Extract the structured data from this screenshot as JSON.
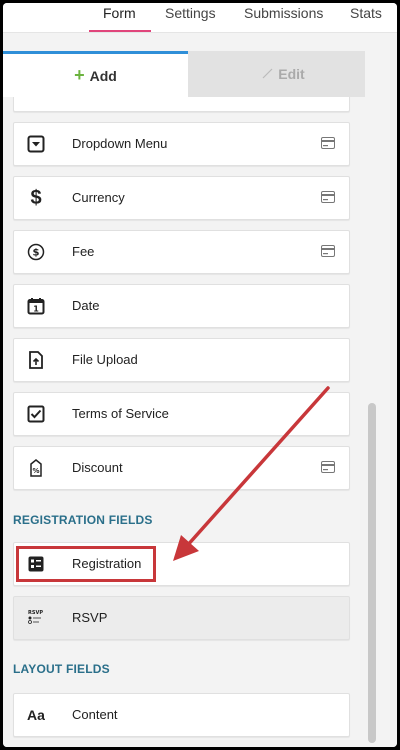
{
  "topnav": {
    "tabs": [
      "Form",
      "Settings",
      "Submissions",
      "Stats"
    ],
    "active": "Form"
  },
  "panel_tabs": {
    "add_label": "Add",
    "edit_label": "Edit"
  },
  "fields": [
    {
      "label": "",
      "icon": "partial-field-icon"
    },
    {
      "label": "Dropdown Menu",
      "icon": "dropdown-icon",
      "badge": true
    },
    {
      "label": "Currency",
      "icon": "dollar-icon",
      "badge": true
    },
    {
      "label": "Fee",
      "icon": "fee-coin-icon",
      "badge": true
    },
    {
      "label": "Date",
      "icon": "calendar-icon"
    },
    {
      "label": "File Upload",
      "icon": "file-upload-icon"
    },
    {
      "label": "Terms of Service",
      "icon": "checkbox-icon"
    },
    {
      "label": "Discount",
      "icon": "discount-tag-icon",
      "badge": true
    }
  ],
  "registration_section": {
    "title": "REGISTRATION FIELDS",
    "items": [
      {
        "label": "Registration",
        "icon": "registration-icon"
      },
      {
        "label": "RSVP",
        "icon": "rsvp-icon"
      }
    ]
  },
  "layout_section": {
    "title": "LAYOUT FIELDS",
    "items": [
      {
        "label": "Content",
        "icon": "content-aa-icon"
      }
    ]
  },
  "colors": {
    "accent_pink": "#e0457b",
    "accent_blue": "#2f8fd8",
    "section_title": "#2a6f8a",
    "highlight_red": "#c8373a"
  }
}
